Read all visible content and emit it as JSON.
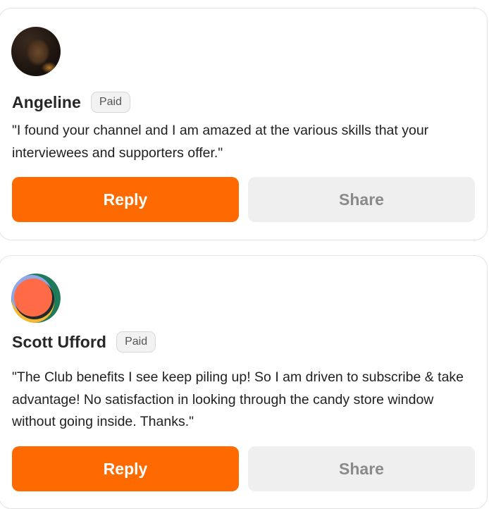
{
  "comments": [
    {
      "name": "Angeline",
      "badge": "Paid",
      "text": "\"I found your channel and I am amazed at the various skills that your interviewees and supporters offer.\"",
      "reply_label": "Reply",
      "share_label": "Share",
      "avatar_icon": "user-photo"
    },
    {
      "name": "Scott Ufford",
      "badge": "Paid",
      "text": "\"The Club benefits I see keep piling up! So I am driven to subscribe & take advantage! No satisfaction in looking through the candy store window without going inside. Thanks.\"",
      "reply_label": "Reply",
      "share_label": "Share",
      "avatar_icon": "abstract-avatar"
    }
  ],
  "colors": {
    "accent": "#ff6a00",
    "share_bg": "#efefef",
    "badge_bg": "#f2f2f2"
  }
}
